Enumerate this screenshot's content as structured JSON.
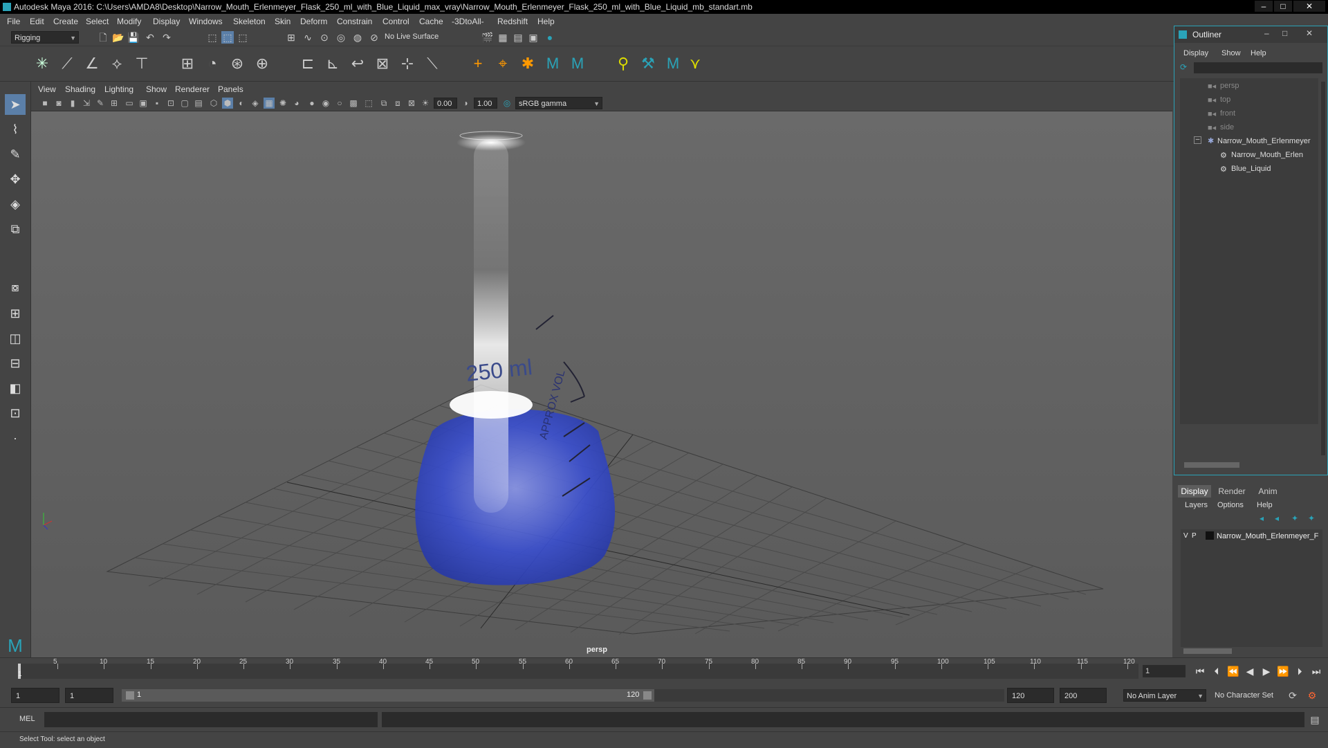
{
  "window": {
    "title": "Autodesk Maya 2016: C:\\Users\\AMDA8\\Desktop\\Narrow_Mouth_Erlenmeyer_Flask_250_ml_with_Blue_Liquid_max_vray\\Narrow_Mouth_Erlenmeyer_Flask_250_ml_with_Blue_Liquid_mb_standart.mb"
  },
  "menubar": [
    "File",
    "Edit",
    "Create",
    "Select",
    "Modify",
    "Display",
    "Windows",
    "Skeleton",
    "Skin",
    "Deform",
    "Constrain",
    "Control",
    "Cache",
    "-3DtoAll-",
    "Redshift",
    "Help"
  ],
  "statusline": {
    "mode": "Rigging",
    "live_surface": "No Live Surface"
  },
  "panel": {
    "menus": [
      "View",
      "Shading",
      "Lighting",
      "Show",
      "Renderer",
      "Panels"
    ],
    "near_value": "0.00",
    "far_value": "1.00",
    "color_space": "sRGB gamma",
    "camera_label": "persp",
    "flask_volume_text": "250 ml",
    "flask_side_text": "APPROX VOL"
  },
  "outliner": {
    "title": "Outliner",
    "menus": [
      "Display",
      "Show",
      "Help"
    ],
    "items": [
      {
        "label": "persp",
        "kind": "camera"
      },
      {
        "label": "top",
        "kind": "camera"
      },
      {
        "label": "front",
        "kind": "camera"
      },
      {
        "label": "side",
        "kind": "camera"
      },
      {
        "label": "Narrow_Mouth_Erlenmeyer",
        "kind": "group"
      },
      {
        "label": "Narrow_Mouth_Erlen",
        "kind": "mesh"
      },
      {
        "label": "Blue_Liquid",
        "kind": "mesh"
      }
    ]
  },
  "layers": {
    "tabs": [
      "Display",
      "Render",
      "Anim"
    ],
    "active_tab": "Display",
    "menus": [
      "Layers",
      "Options",
      "Help"
    ],
    "layer": {
      "v": "V",
      "p": "P",
      "name": "Narrow_Mouth_Erlenmeyer_F"
    }
  },
  "timeline": {
    "ticks": [
      "5",
      "10",
      "15",
      "20",
      "25",
      "30",
      "35",
      "40",
      "45",
      "50",
      "55",
      "60",
      "65",
      "70",
      "75",
      "80",
      "85",
      "90",
      "95",
      "100",
      "105",
      "110",
      "115",
      "120"
    ],
    "start_tick": "1",
    "current_frame": "1"
  },
  "range": {
    "start": "1",
    "playback_start": "1",
    "slider_start": "1",
    "slider_end": "120",
    "playback_end": "120",
    "end": "200",
    "anim_layer": "No Anim Layer",
    "character_set": "No Character Set"
  },
  "cmdline": {
    "label": "MEL"
  },
  "helpline": {
    "text": "Select Tool: select an object"
  },
  "colors": {
    "accent": "#2aa3b8",
    "liquid": "#3a4fd0"
  }
}
